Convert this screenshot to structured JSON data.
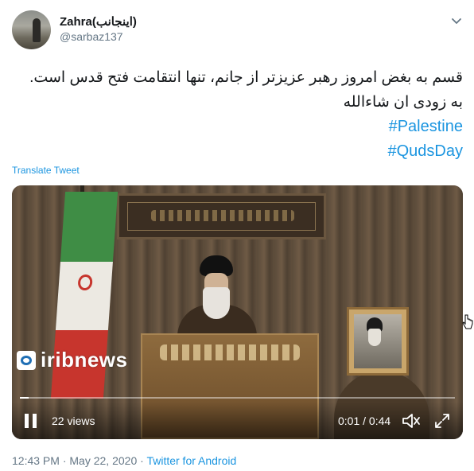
{
  "header": {
    "display_name": "Zahra(اینجانب)",
    "username": "@sarbaz137"
  },
  "tweet": {
    "lines": [
      "قسم به بغض امروز رهبر عزیزتر از جانم، تنها انتقامت فتح قدس است.",
      "به زودی ان شاءالله"
    ],
    "hashtags": [
      "#Palestine",
      "#QudsDay"
    ],
    "translate_label": "Translate Tweet"
  },
  "video": {
    "watermark": "iribnews",
    "views": "22 views",
    "time": "0:01 / 0:44",
    "progress": 0.02
  },
  "footer": {
    "time": "12:43 PM",
    "separator": "·",
    "date": "May 22, 2020",
    "source": "Twitter for Android"
  },
  "icons": [
    "chevron-down-icon",
    "pause-icon",
    "volume-muted-icon",
    "fullscreen-icon",
    "pointer-cursor-icon"
  ],
  "colors": {
    "link": "#1b95e0",
    "muted_text": "#657786",
    "text": "#14171a"
  }
}
